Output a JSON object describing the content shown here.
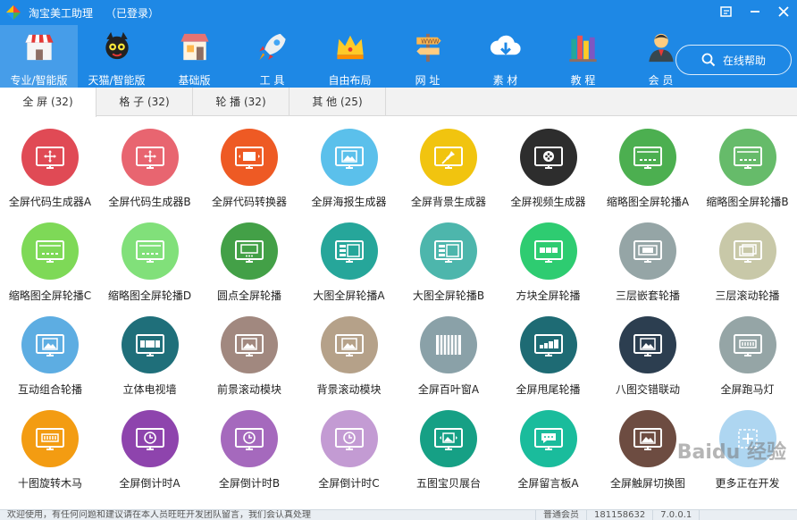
{
  "app": {
    "title": "淘宝美工助理",
    "login_status": "（已登录）",
    "window_controls": [
      "restore-icon",
      "minimize-icon",
      "close-icon"
    ]
  },
  "nav": {
    "items": [
      {
        "label": "专业/智能版",
        "icon": "shop-icon",
        "active": true
      },
      {
        "label": "天猫/智能版",
        "icon": "tmall-cat-icon",
        "active": false
      },
      {
        "label": "基础版",
        "icon": "store-icon",
        "active": false
      },
      {
        "label": "工 具",
        "icon": "rocket-icon",
        "active": false
      },
      {
        "label": "自由布局",
        "icon": "crown-icon",
        "active": false
      },
      {
        "label": "网 址",
        "icon": "signpost-icon",
        "active": false
      },
      {
        "label": "素 材",
        "icon": "cloud-download-icon",
        "active": false
      },
      {
        "label": "教 程",
        "icon": "books-icon",
        "active": false
      },
      {
        "label": "会 员",
        "icon": "member-avatar-icon",
        "active": false
      }
    ],
    "help_label": "在线帮助"
  },
  "tabs": [
    {
      "label": "全 屏 (32)",
      "active": true
    },
    {
      "label": "格 子 (32)",
      "active": false
    },
    {
      "label": "轮 播 (32)",
      "active": false
    },
    {
      "label": "其 他 (25)",
      "active": false
    }
  ],
  "tools": [
    {
      "label": "全屏代码生成器A",
      "color": "#e04a55",
      "icon": "move-arrows-icon"
    },
    {
      "label": "全屏代码生成器B",
      "color": "#e86570",
      "icon": "move-arrows-icon"
    },
    {
      "label": "全屏代码转换器",
      "color": "#ee5a24",
      "icon": "slideshow-icon"
    },
    {
      "label": "全屏海报生成器",
      "color": "#5bc0eb",
      "icon": "image-icon"
    },
    {
      "label": "全屏背景生成器",
      "color": "#f1c40f",
      "icon": "pin-icon"
    },
    {
      "label": "全屏视频生成器",
      "color": "#2d2d2d",
      "icon": "film-icon"
    },
    {
      "label": "缩略图全屏轮播A",
      "color": "#4caf50",
      "icon": "thumbnail-slider-icon"
    },
    {
      "label": "缩略图全屏轮播B",
      "color": "#66bb6a",
      "icon": "thumbnail-slider-icon"
    },
    {
      "label": "缩略图全屏轮播C",
      "color": "#7ed957",
      "icon": "thumbnail-slider-icon"
    },
    {
      "label": "缩略图全屏轮播D",
      "color": "#81e07a",
      "icon": "thumbnail-slider-icon"
    },
    {
      "label": "圆点全屏轮播",
      "color": "#43a047",
      "icon": "dots-slider-icon"
    },
    {
      "label": "大图全屏轮播A",
      "color": "#26a69a",
      "icon": "big-image-slider-icon"
    },
    {
      "label": "大图全屏轮播B",
      "color": "#4db6ac",
      "icon": "big-image-slider-icon"
    },
    {
      "label": "方块全屏轮播",
      "color": "#2ecc71",
      "icon": "blocks-slider-icon"
    },
    {
      "label": "三层嵌套轮播",
      "color": "#95a5a6",
      "icon": "nested-slider-icon"
    },
    {
      "label": "三层滚动轮播",
      "color": "#c8c8a8",
      "icon": "stacked-images-icon"
    },
    {
      "label": "互动组合轮播",
      "color": "#5dade2",
      "icon": "image-icon"
    },
    {
      "label": "立体电视墙",
      "color": "#1f6f7a",
      "icon": "tv-wall-icon"
    },
    {
      "label": "前景滚动模块",
      "color": "#a1887f",
      "icon": "image-icon"
    },
    {
      "label": "背景滚动模块",
      "color": "#b5a189",
      "icon": "image-icon"
    },
    {
      "label": "全屏百叶窗A",
      "color": "#8aa1a8",
      "icon": "blinds-icon"
    },
    {
      "label": "全屏甩尾轮播",
      "color": "#1e6b74",
      "icon": "tail-slider-icon"
    },
    {
      "label": "八图交错联动",
      "color": "#2c3e50",
      "icon": "image-icon"
    },
    {
      "label": "全屏跑马灯",
      "color": "#95a5a6",
      "icon": "marquee-icon"
    },
    {
      "label": "十图旋转木马",
      "color": "#f39c12",
      "icon": "carousel-icon"
    },
    {
      "label": "全屏倒计时A",
      "color": "#8e44ad",
      "icon": "clock-icon"
    },
    {
      "label": "全屏倒计时B",
      "color": "#a569bd",
      "icon": "clock-icon"
    },
    {
      "label": "全屏倒计时C",
      "color": "#c39bd3",
      "icon": "clock-icon"
    },
    {
      "label": "五图宝贝展台",
      "color": "#16a085",
      "icon": "showcase-icon"
    },
    {
      "label": "全屏留言板A",
      "color": "#1abc9c",
      "icon": "chat-bubble-icon"
    },
    {
      "label": "全屏触屏切换图",
      "color": "#6d4c41",
      "icon": "image-icon"
    },
    {
      "label": "更多正在开发",
      "color": "#aed6f1",
      "icon": "plus-icon"
    }
  ],
  "statusbar": {
    "notice": "欢迎使用，有任何问题和建议请在本人员旺旺开发团队留言，我们会认真处理",
    "member_level": "普通会员",
    "account": "181158632",
    "version": "7.0.0.1"
  },
  "watermark": "Baidu 经验"
}
